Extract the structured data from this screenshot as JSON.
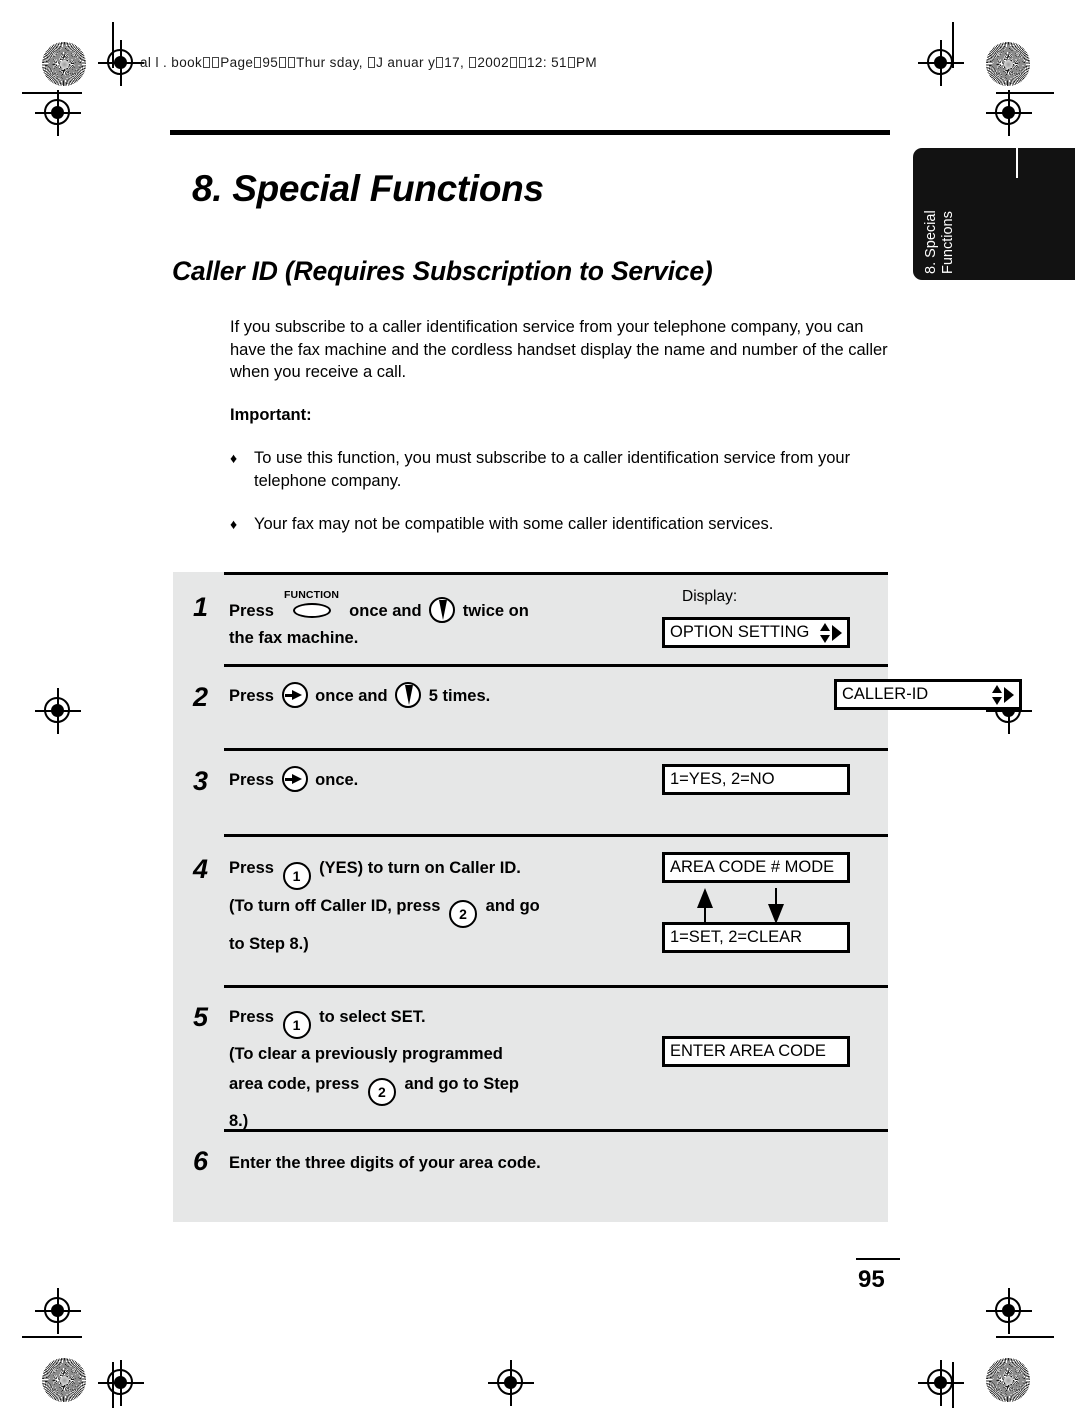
{
  "book_header": {
    "prefix": "al l . book",
    "segments": [
      "Page",
      "95",
      "Thur sday, ",
      "J anuar y",
      "17, ",
      "2002",
      "12: 51",
      "PM"
    ],
    "full_text": "all.book  Page 95  Thursday, January 17, 2002  12:51 PM"
  },
  "side_tab": {
    "line1": "8. Special",
    "line2": "Functions"
  },
  "chapter_title": "8.  Special Functions",
  "section_title": "Caller ID (Requires Subscription to Service)",
  "intro_paragraph": "If you subscribe to a caller identification service from your telephone company, you can have the fax machine and the cordless handset display the name and number of the caller when you receive a call.",
  "important_label": "Important:",
  "bullets": [
    {
      "mark": "♦",
      "text": "To use this function, you must subscribe to a caller identification service from your telephone company."
    },
    {
      "mark": "♦",
      "text": "Your fax may not be compatible with some caller identification services."
    }
  ],
  "display_label": "Display:",
  "steps": [
    {
      "number": "1",
      "line1_a": "Press",
      "key1": "FUNCTION",
      "line1_b": "once and",
      "line1_c": "twice on",
      "line2": "the fax machine.",
      "lcd": "OPTION SETTING"
    },
    {
      "number": "2",
      "line1_a": "Press",
      "line1_b": "once and",
      "line1_c": "5 times.",
      "lcd": "CALLER-ID"
    },
    {
      "number": "3",
      "line1_a": "Press",
      "line1_b": "once.",
      "lcd": "1=YES, 2=NO"
    },
    {
      "number": "4",
      "line1_a": "Press",
      "key_num_1": "1",
      "line1_b": "(YES) to turn on Caller ID.",
      "line2_a": "(To turn off Caller ID, press",
      "key_num_2": "2",
      "line2_b": "and go",
      "line3": "to Step 8.)",
      "lcd_top": "AREA CODE # MODE",
      "lcd_bottom": "1=SET, 2=CLEAR"
    },
    {
      "number": "5",
      "line1_a": "Press",
      "key_num_1": "1",
      "line1_b": "to select SET.",
      "line2": "(To clear a previously programmed",
      "line3_a": "area code, press",
      "key_num_2": "2",
      "line3_b": "and go to Step",
      "line4": "8.)",
      "lcd": "ENTER AREA CODE"
    },
    {
      "number": "6",
      "line1": "Enter the three digits of your area code."
    }
  ],
  "page_number": "95",
  "colors": {
    "panel_background": "#e6e7e7",
    "tab_background": "#121212",
    "ink": "#000000",
    "paper": "#ffffff"
  }
}
